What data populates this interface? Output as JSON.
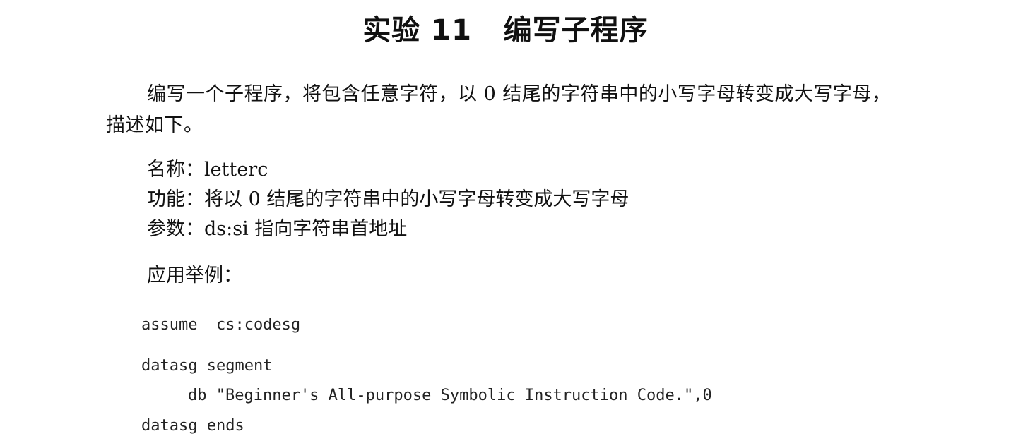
{
  "title": "实验 11   编写子程序",
  "intro": "编写一个子程序，将包含任意字符，以 0 结尾的字符串中的小写字母转变成大写字母，描述如下。",
  "description": {
    "name": "名称：letterc",
    "function": "功能：将以 0 结尾的字符串中的小写字母转变成大写字母",
    "params": "参数：ds:si 指向字符串首地址"
  },
  "example_label": "应用举例：",
  "code": [
    "assume  cs:codesg",
    "datasg segment",
    "db \"Beginner's All-purpose Symbolic Instruction Code.\",0",
    "datasg ends"
  ]
}
